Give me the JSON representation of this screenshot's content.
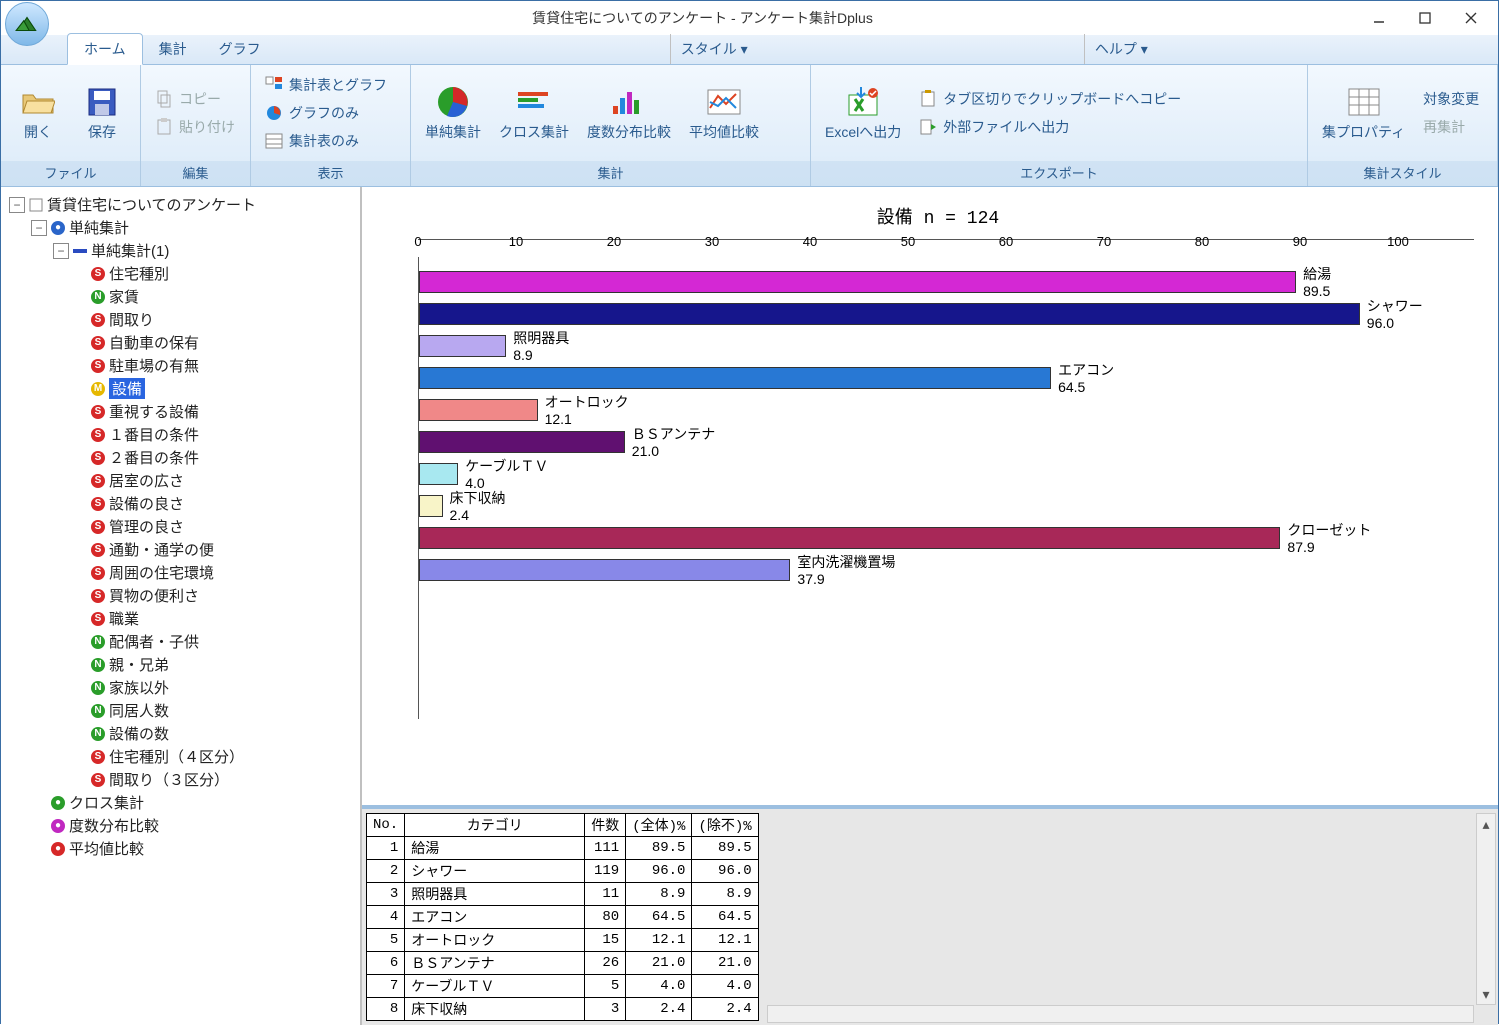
{
  "window": {
    "title": "賃貸住宅についてのアンケート - アンケート集計Dplus"
  },
  "menu": {
    "tabs": [
      "ホーム",
      "集計",
      "グラフ"
    ],
    "style": "スタイル ▾",
    "help": "ヘルプ ▾"
  },
  "ribbon": {
    "file": {
      "label": "ファイル",
      "open": "開く",
      "save": "保存"
    },
    "edit": {
      "label": "編集",
      "copy": "コピー",
      "paste": "貼り付け"
    },
    "view": {
      "label": "表示",
      "a": "集計表とグラフ",
      "b": "グラフのみ",
      "c": "集計表のみ"
    },
    "agg": {
      "label": "集計",
      "a": "単純集計",
      "b": "クロス集計",
      "c": "度数分布比較",
      "d": "平均値比較"
    },
    "export": {
      "label": "エクスポート",
      "excel": "Excelへ出力",
      "clip": "タブ区切りでクリップボードへコピー",
      "ext": "外部ファイルへ出力"
    },
    "style": {
      "label": "集計スタイル",
      "prop": "集プロパティ",
      "target": "対象変更",
      "reagg": "再集計"
    }
  },
  "tree": {
    "root": "賃貸住宅についてのアンケート",
    "simple": "単純集計",
    "simple1": "単純集計(1)",
    "items": [
      {
        "t": "S",
        "l": "住宅種別"
      },
      {
        "t": "N",
        "l": "家賃"
      },
      {
        "t": "S",
        "l": "間取り"
      },
      {
        "t": "S",
        "l": "自動車の保有"
      },
      {
        "t": "S",
        "l": "駐車場の有無"
      },
      {
        "t": "M",
        "l": "設備",
        "sel": true
      },
      {
        "t": "S",
        "l": "重視する設備"
      },
      {
        "t": "S",
        "l": "１番目の条件"
      },
      {
        "t": "S",
        "l": "２番目の条件"
      },
      {
        "t": "S",
        "l": "居室の広さ"
      },
      {
        "t": "S",
        "l": "設備の良さ"
      },
      {
        "t": "S",
        "l": "管理の良さ"
      },
      {
        "t": "S",
        "l": "通勤・通学の便"
      },
      {
        "t": "S",
        "l": "周囲の住宅環境"
      },
      {
        "t": "S",
        "l": "買物の便利さ"
      },
      {
        "t": "S",
        "l": "職業"
      },
      {
        "t": "N",
        "l": "配偶者・子供"
      },
      {
        "t": "N",
        "l": "親・兄弟"
      },
      {
        "t": "N",
        "l": "家族以外"
      },
      {
        "t": "N",
        "l": "同居人数"
      },
      {
        "t": "N",
        "l": "設備の数"
      },
      {
        "t": "S",
        "l": "住宅種別（４区分）"
      },
      {
        "t": "S",
        "l": "間取り（３区分）"
      }
    ],
    "cross": "クロス集計",
    "freq": "度数分布比較",
    "mean": "平均値比較"
  },
  "chart_data": {
    "type": "bar",
    "title": "設備      n = 124",
    "xlim": [
      0,
      100
    ],
    "ticks": [
      0,
      10,
      20,
      30,
      40,
      50,
      60,
      70,
      80,
      90,
      100
    ],
    "series": [
      {
        "name": "給湯",
        "value": 89.5,
        "color": "#d428d4"
      },
      {
        "name": "シャワー",
        "value": 96.0,
        "color": "#16168c"
      },
      {
        "name": "照明器具",
        "value": 8.9,
        "color": "#b8a8f0"
      },
      {
        "name": "エアコン",
        "value": 64.5,
        "color": "#2878d4"
      },
      {
        "name": "オートロック",
        "value": 12.1,
        "color": "#f08888"
      },
      {
        "name": "ＢＳアンテナ",
        "value": 21.0,
        "color": "#601070"
      },
      {
        "name": "ケーブルＴＶ",
        "value": 4.0,
        "color": "#a8e8f0"
      },
      {
        "name": "床下収納",
        "value": 2.4,
        "color": "#f8f4c8"
      },
      {
        "name": "クローゼット",
        "value": 87.9,
        "color": "#a82858"
      },
      {
        "name": "室内洗濯機置場",
        "value": 37.9,
        "color": "#8888e8"
      }
    ]
  },
  "table": {
    "headers": [
      "No.",
      "カテゴリ",
      "件数",
      "(全体)%",
      "(除不)%"
    ],
    "rows": [
      [
        1,
        "給湯",
        111,
        "89.5",
        "89.5"
      ],
      [
        2,
        "シャワー",
        119,
        "96.0",
        "96.0"
      ],
      [
        3,
        "照明器具",
        11,
        "8.9",
        "8.9"
      ],
      [
        4,
        "エアコン",
        80,
        "64.5",
        "64.5"
      ],
      [
        5,
        "オートロック",
        15,
        "12.1",
        "12.1"
      ],
      [
        6,
        "ＢＳアンテナ",
        26,
        "21.0",
        "21.0"
      ],
      [
        7,
        "ケーブルＴＶ",
        5,
        "4.0",
        "4.0"
      ],
      [
        8,
        "床下収納",
        3,
        "2.4",
        "2.4"
      ]
    ]
  }
}
